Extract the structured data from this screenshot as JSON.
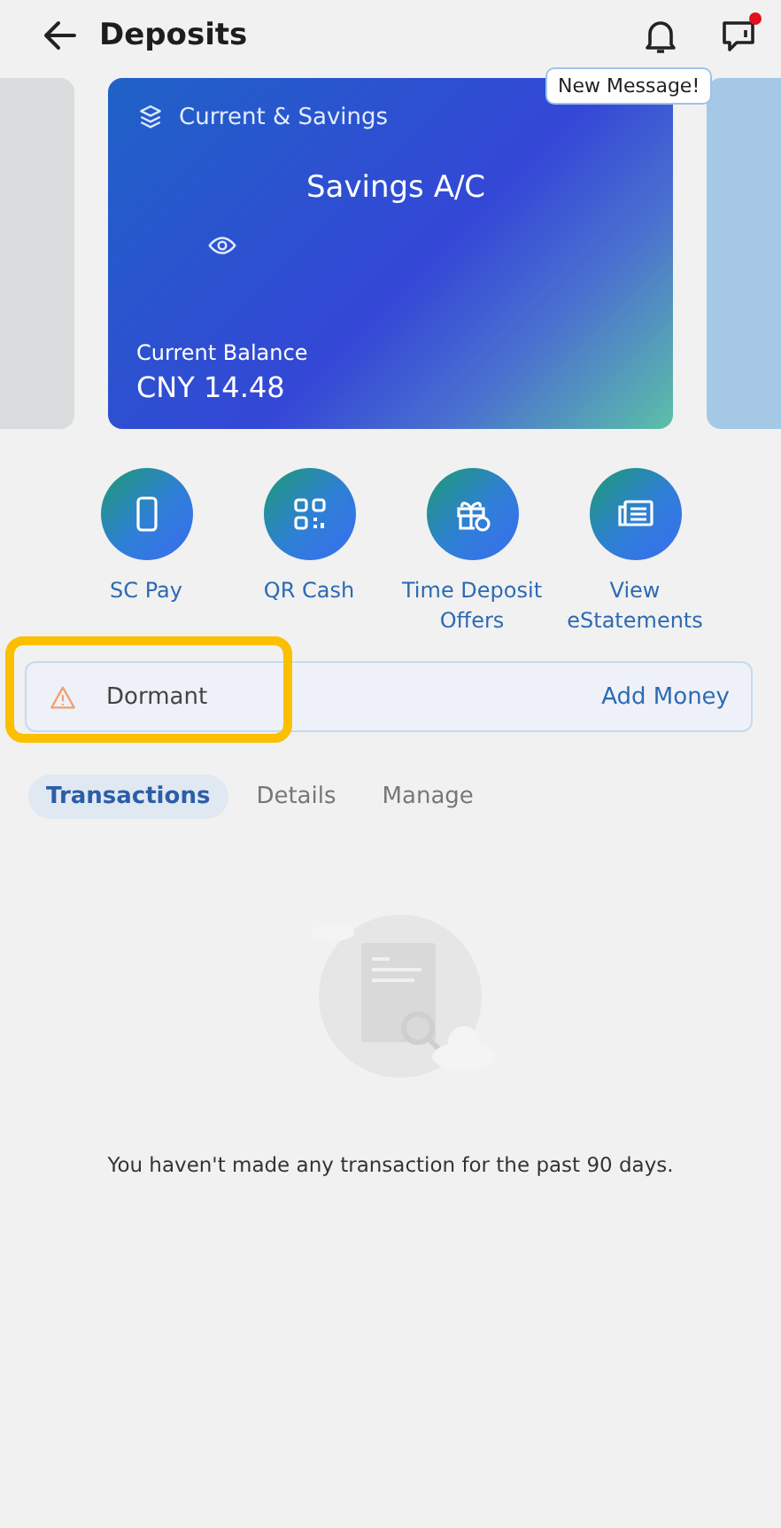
{
  "header": {
    "title": "Deposits",
    "notification_dot": true,
    "tooltip": "New Message!"
  },
  "account_card": {
    "category": "Current & Savings",
    "name": "Savings A/C",
    "balance_label": "Current Balance",
    "balance": "CNY 14.48"
  },
  "actions": [
    {
      "kind": "phone",
      "label": "SC Pay"
    },
    {
      "kind": "qr",
      "label": "QR Cash"
    },
    {
      "kind": "gift",
      "label": "Time Deposit Offers"
    },
    {
      "kind": "statement",
      "label": "View eStatements"
    }
  ],
  "status_banner": {
    "status": "Dormant",
    "action": "Add Money",
    "highlighted": true
  },
  "tabs": [
    {
      "label": "Transactions",
      "selected": true
    },
    {
      "label": "Details",
      "selected": false
    },
    {
      "label": "Manage",
      "selected": false
    }
  ],
  "empty_state": {
    "message": "You haven't made any transaction for the past 90 days."
  }
}
